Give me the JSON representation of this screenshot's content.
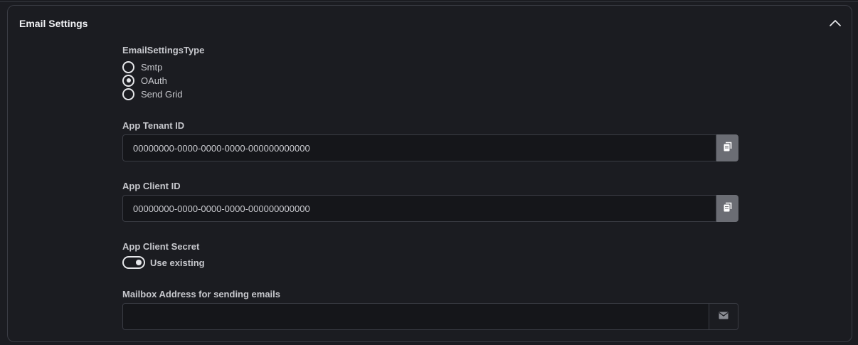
{
  "section": {
    "title": "Email Settings",
    "collapse_icon": "chevron-up-icon"
  },
  "email_settings_type": {
    "label": "EmailSettingsType",
    "options": [
      {
        "label": "Smtp",
        "checked": false
      },
      {
        "label": "OAuth",
        "checked": true
      },
      {
        "label": "Send Grid",
        "checked": false
      }
    ]
  },
  "tenant_id": {
    "label": "App Tenant ID",
    "value": "00000000-0000-0000-0000-000000000000",
    "copy_icon": "copy-icon"
  },
  "client_id": {
    "label": "App Client ID",
    "value": "00000000-0000-0000-0000-000000000000",
    "copy_icon": "copy-icon"
  },
  "client_secret": {
    "label": "App Client Secret",
    "toggle_label": "Use existing",
    "toggle_on": true
  },
  "mailbox": {
    "label": "Mailbox Address for sending emails",
    "value": "",
    "addon_icon": "envelope-icon"
  },
  "colors": {
    "background": "#1b1c21",
    "border": "#3a3c44",
    "input_bg": "#15161a",
    "copy_button_bg": "#6b6d74"
  }
}
